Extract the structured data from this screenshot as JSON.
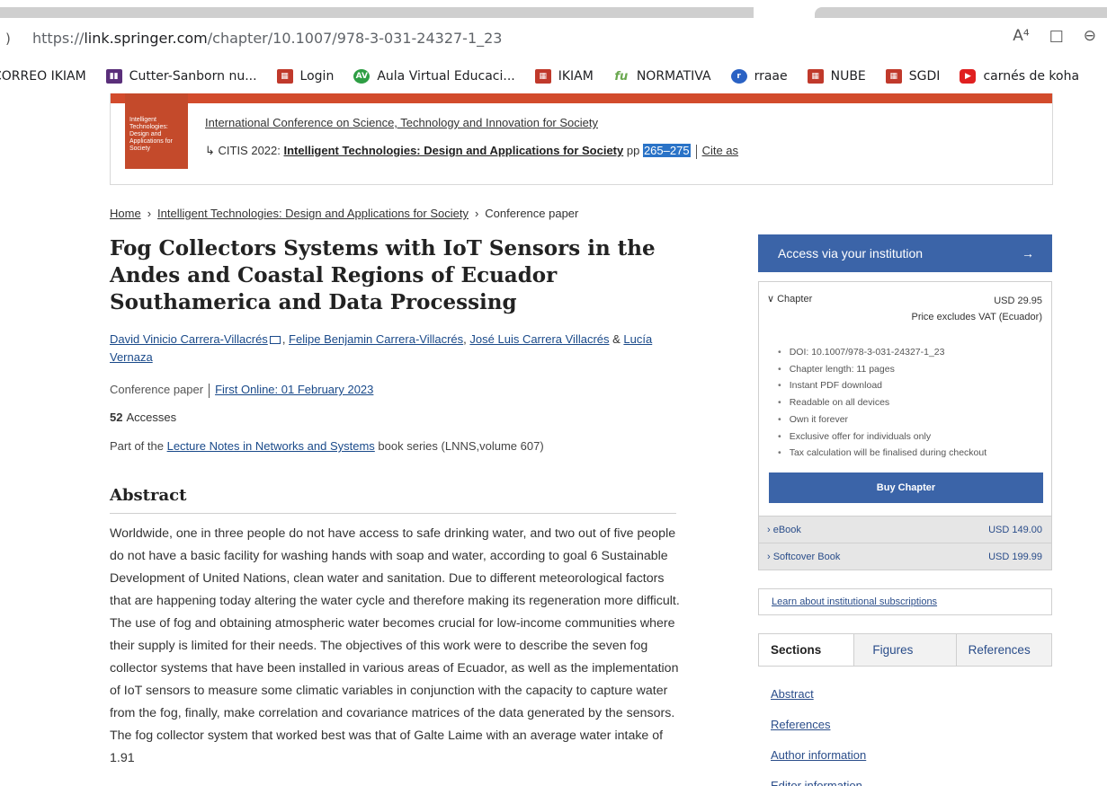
{
  "browser": {
    "url_prefix": "https://",
    "url_domain": "link.springer.com",
    "url_path": "/chapter/10.1007/978-3-031-24327-1_23",
    "icons": [
      "read-aloud-icon",
      "immersive-reader-icon",
      "zoom-out-icon"
    ],
    "read_aloud_glyph": "A⁴",
    "reader_glyph": "□",
    "zoom_glyph": "⊖",
    "back_glyph": ")"
  },
  "bookmarks": [
    {
      "label": "CORREO IKIAM",
      "icon": "none",
      "color": ""
    },
    {
      "label": "Cutter-Sanborn nu...",
      "icon": "book-icon",
      "color": "#5a2f7a"
    },
    {
      "label": "Login",
      "icon": "ikiam-icon",
      "color": "#c0392b"
    },
    {
      "label": "Aula Virtual Educaci...",
      "icon": "av-icon",
      "color": "#2e9e44"
    },
    {
      "label": "IKIAM",
      "icon": "ikiam-icon",
      "color": "#c0392b"
    },
    {
      "label": "NORMATIVA",
      "icon": "fu-icon",
      "color": "#6aa84f"
    },
    {
      "label": "rraae",
      "icon": "rraae-icon",
      "color": "#2a62c4"
    },
    {
      "label": "NUBE",
      "icon": "ikiam-icon",
      "color": "#c0392b"
    },
    {
      "label": "SGDI",
      "icon": "ikiam-icon",
      "color": "#c0392b"
    },
    {
      "label": "carnés de koha",
      "icon": "youtube-icon",
      "color": "#e02020"
    }
  ],
  "book": {
    "cover_lines": "Intelligent Technologies: Design and Applications for Society",
    "conference_link": "International Conference on Science, Technology and Innovation for Society",
    "series_prefix": "↳ CITIS 2022: ",
    "book_title": "Intelligent Technologies: Design and Applications for Society",
    "pp_label": " pp ",
    "pages": "265–275",
    "cite_as": "Cite as"
  },
  "breadcrumb": {
    "home": "Home",
    "book": "Intelligent Technologies: Design and Applications for Society",
    "current": "Conference paper",
    "sep": "›"
  },
  "article": {
    "title": "Fog Collectors Systems with IoT Sensors in the Andes and Coastal Regions of Ecuador Southamerica and Data Processing",
    "authors": [
      "David Vinicio Carrera-Villacrés",
      "Felipe Benjamin Carrera-Villacrés",
      "José Luis Carrera Villacrés",
      "Lucía Vernaza"
    ],
    "author_sep": ", ",
    "author_amp": " & ",
    "type": "Conference paper",
    "first_online": "First Online: 01 February 2023",
    "accesses_count": "52",
    "accesses_label": "Accesses",
    "part_of_prefix": "Part of the ",
    "series_link": "Lecture Notes in Networks and Systems",
    "part_of_suffix": " book series (LNNS,volume 607)",
    "abstract_heading": "Abstract",
    "abstract_text": "Worldwide, one in three people do not have access to safe drinking water, and two out of five people do not have a basic facility for washing hands with soap and water, according to goal 6 Sustainable Development of United Nations, clean water and sanitation. Due to different meteorological factors that are happening today altering the water cycle and therefore making its regeneration more difficult. The use of fog and obtaining atmospheric water becomes crucial for low-income communities where their supply is limited for their needs. The objectives of this work were to describe the seven fog collector systems that have been installed in various areas of Ecuador, as well as the implementation of IoT sensors to measure some climatic variables in conjunction with the capacity to capture water from the fog, finally, make correlation and covariance matrices of the data generated by the sensors. The fog collector system that worked best was that of Galte Laime with an average water intake of 1.91"
  },
  "sidebar": {
    "access_label": "Access via your institution",
    "access_arrow": "→",
    "chapter_toggle": "∨  Chapter",
    "chapter_price": "USD  29.95",
    "vat_note": "Price excludes VAT (Ecuador)",
    "features": [
      "DOI: 10.1007/978-3-031-24327-1_23",
      "Chapter length: 11 pages",
      "Instant PDF download",
      "Readable on all devices",
      "Own it forever",
      "Exclusive offer for individuals only",
      "Tax calculation will be finalised during checkout"
    ],
    "buy_label": "Buy Chapter",
    "ebook_label": "›  eBook",
    "ebook_price": "USD  149.00",
    "softcover_label": "›  Softcover Book",
    "softcover_price": "USD  199.99",
    "learn_link": "Learn about institutional subscriptions",
    "tabs": [
      "Sections",
      "Figures",
      "References"
    ],
    "section_links": [
      "Abstract",
      "References",
      "Author information",
      "Editor information"
    ]
  },
  "colors": {
    "accent_blue": "#3b64a8",
    "springer_red": "#d24b2c",
    "highlight": "#2a73c7"
  }
}
